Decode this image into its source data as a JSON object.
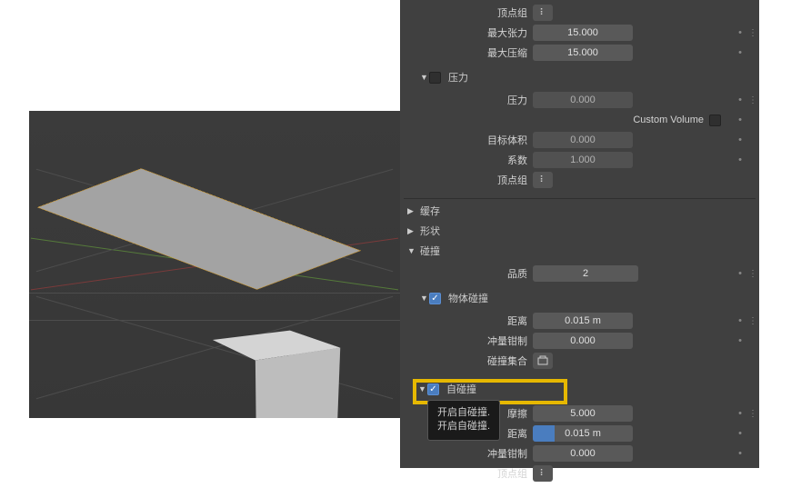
{
  "top_rows": {
    "vertex_group_top": "顶点组",
    "max_tension": {
      "label": "最大张力",
      "value": "15.000"
    },
    "max_compress": {
      "label": "最大压缩",
      "value": "15.000"
    }
  },
  "pressure": {
    "header": "压力",
    "pressure": {
      "label": "压力",
      "value": "0.000"
    },
    "custom_volume": {
      "label": "Custom Volume"
    },
    "target_volume": {
      "label": "目标体积",
      "value": "0.000"
    },
    "factor": {
      "label": "系数",
      "value": "1.000"
    },
    "vertex_group": {
      "label": "顶点组"
    }
  },
  "sections": {
    "cache": "缓存",
    "shape": "形状",
    "collision": "碰撞"
  },
  "collision_quality": {
    "label": "品质",
    "value": "2"
  },
  "obj_collision": {
    "header": "物体碰撞",
    "distance": {
      "label": "距离",
      "value": "0.015 m"
    },
    "impulse": {
      "label": "冲量钳制",
      "value": "0.000"
    },
    "collection": {
      "label": "碰撞集合"
    }
  },
  "self_collision": {
    "header": "自碰撞",
    "friction": {
      "label": "摩擦",
      "value": "5.000"
    },
    "distance": {
      "label": "距离",
      "value": "0.015 m"
    },
    "impulse": {
      "label": "冲量钳制",
      "value": "0.000"
    },
    "vertex_group": {
      "label": "顶点组"
    }
  },
  "tooltip": {
    "line1": "开启自碰撞.",
    "line2": "开启自碰撞."
  }
}
